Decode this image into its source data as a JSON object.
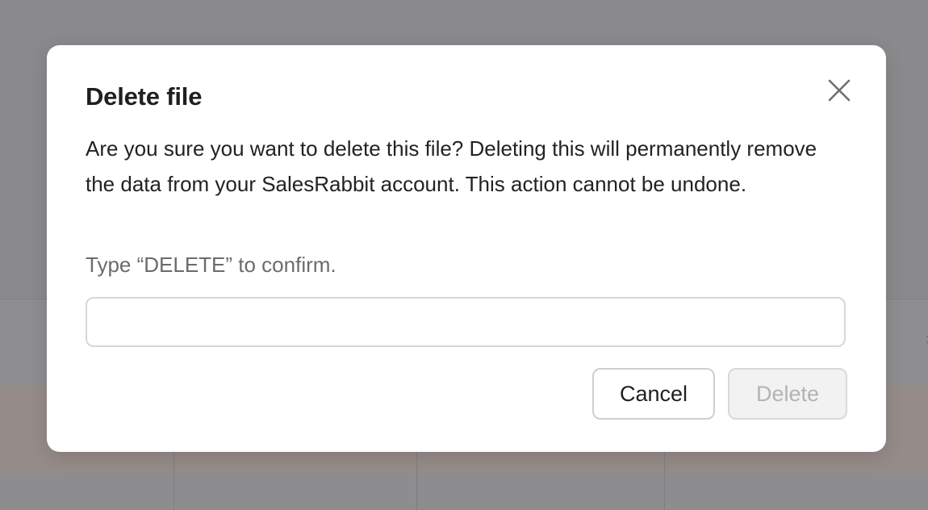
{
  "modal": {
    "title": "Delete file",
    "message": "Are you sure you want to delete this file? Deleting this will permanently remove the data from your SalesRabbit account. This action cannot be undone.",
    "confirm_label": "Type “DELETE” to confirm.",
    "input_value": "",
    "input_placeholder": "",
    "cancel_label": "Cancel",
    "delete_label": "Delete",
    "delete_enabled": false,
    "close_icon": "close-icon"
  },
  "colors": {
    "overlay": "#8a8a8c",
    "modal_background": "#ffffff",
    "title_text": "#1f1f1f",
    "label_text": "#6b6b6b",
    "disabled_text": "#b3b3b3"
  }
}
